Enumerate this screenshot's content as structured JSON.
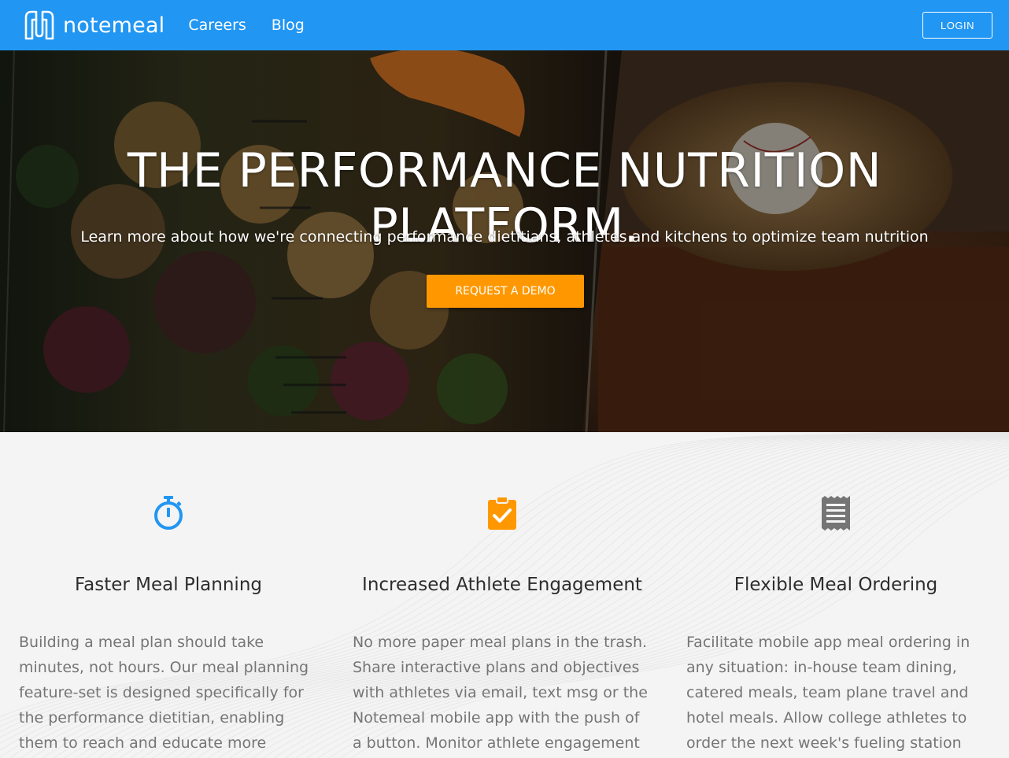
{
  "nav": {
    "brand": "notemeal",
    "links": [
      "Careers",
      "Blog"
    ],
    "login_label": "LOGIN"
  },
  "hero": {
    "title": "THE PERFORMANCE NUTRITION PLATFORM.",
    "subtitle": "Learn more about how we're connecting performance dietitians, athletes and kitchens to optimize team nutrition",
    "cta_label": "REQUEST A DEMO"
  },
  "features": [
    {
      "icon": "stopwatch-icon",
      "title": "Faster Meal Planning",
      "text": "Building a meal plan should take minutes, not hours. Our meal planning feature-set is designed specifically for the performance dietitian, enabling them to reach and educate more athletes, in less"
    },
    {
      "icon": "clipboard-check-icon",
      "title": "Increased Athlete Engagement",
      "text": "No more paper meal plans in the trash. Share interactive plans and objectives with athletes via email, text msg or the Notemeal mobile app with the push of a button. Monitor athlete engagement and"
    },
    {
      "icon": "receipt-icon",
      "title": "Flexible Meal Ordering",
      "text": "Facilitate mobile app meal ordering in any situation: in-house team dining, catered meals, team plane travel and hotel meals. Allow college athletes to order the next week's fueling station items for pick-up."
    }
  ],
  "colors": {
    "brand_blue": "#2196f3",
    "cta_orange": "#ff9800",
    "icon_blue": "#2196f3",
    "icon_orange": "#ff9800",
    "icon_gray": "#757575"
  }
}
